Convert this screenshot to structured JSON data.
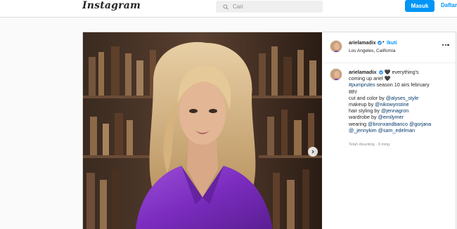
{
  "topbar": {
    "logo": "Instagram",
    "search_placeholder": "Cari",
    "login_label": "Masuk",
    "signup_label": "Daftar"
  },
  "post": {
    "username": "arielamadix",
    "follow_separator": "•",
    "follow_label": "Ikuti",
    "location": "Los Angeles, California",
    "caption": {
      "username": "arielamadix",
      "line1_text": "🖤 everything's",
      "line2_text": "coming up ariel 🖤",
      "hashtag": "#pumprules",
      "line3_rest": " season 10 airs february",
      "line4_text": "8th!",
      "line5_prefix": "cut and color by ",
      "line5_mention": "@alyses_style",
      "line6_prefix": "makeup by ",
      "line6_mention": "@nikowynstine",
      "line7_prefix": "hair styling by ",
      "line7_mention": "@jennagron",
      "line8_prefix": "wardrobe by ",
      "line8_mention": "@emilymer",
      "line9_prefix": "wearing ",
      "line9_mention1": "@bronxandbanco",
      "line9_mid": " ",
      "line9_mention2": "@gorjana",
      "line10_mention1": "@_jennykim",
      "line10_mid": " ",
      "line10_mention2": "@sam_edelman"
    },
    "timestamp": "Telah disunting · 9 ming"
  },
  "colors": {
    "accent": "#0095f6",
    "dress": "#7b2cbf",
    "link": "#00376b"
  },
  "icons": [
    "search-icon",
    "verified-icon",
    "more-icon",
    "chevron-right-icon"
  ]
}
